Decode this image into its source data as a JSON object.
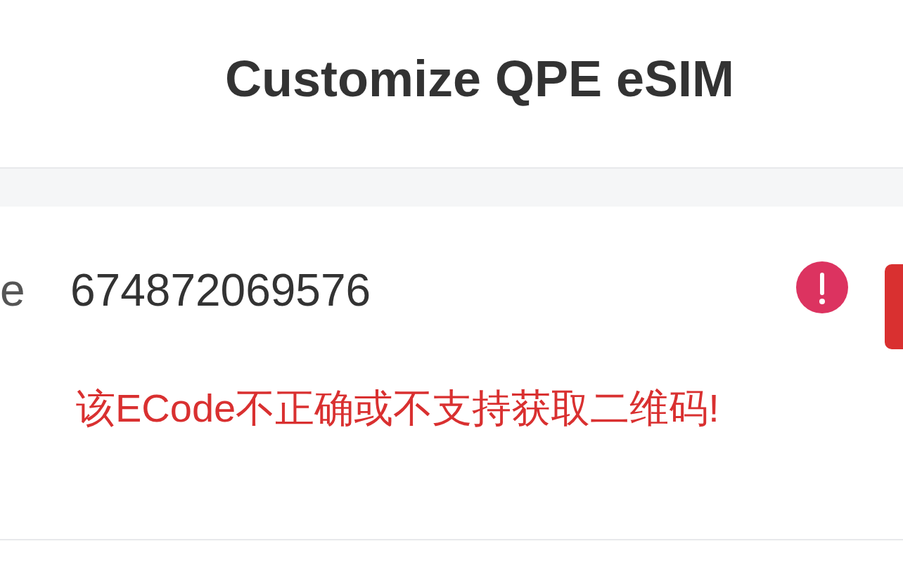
{
  "header": {
    "title": "Customize QPE eSIM"
  },
  "form": {
    "label": "e",
    "value": "674872069576",
    "error": true,
    "error_message": "该ECode不正确或不支持获取二维码!"
  }
}
